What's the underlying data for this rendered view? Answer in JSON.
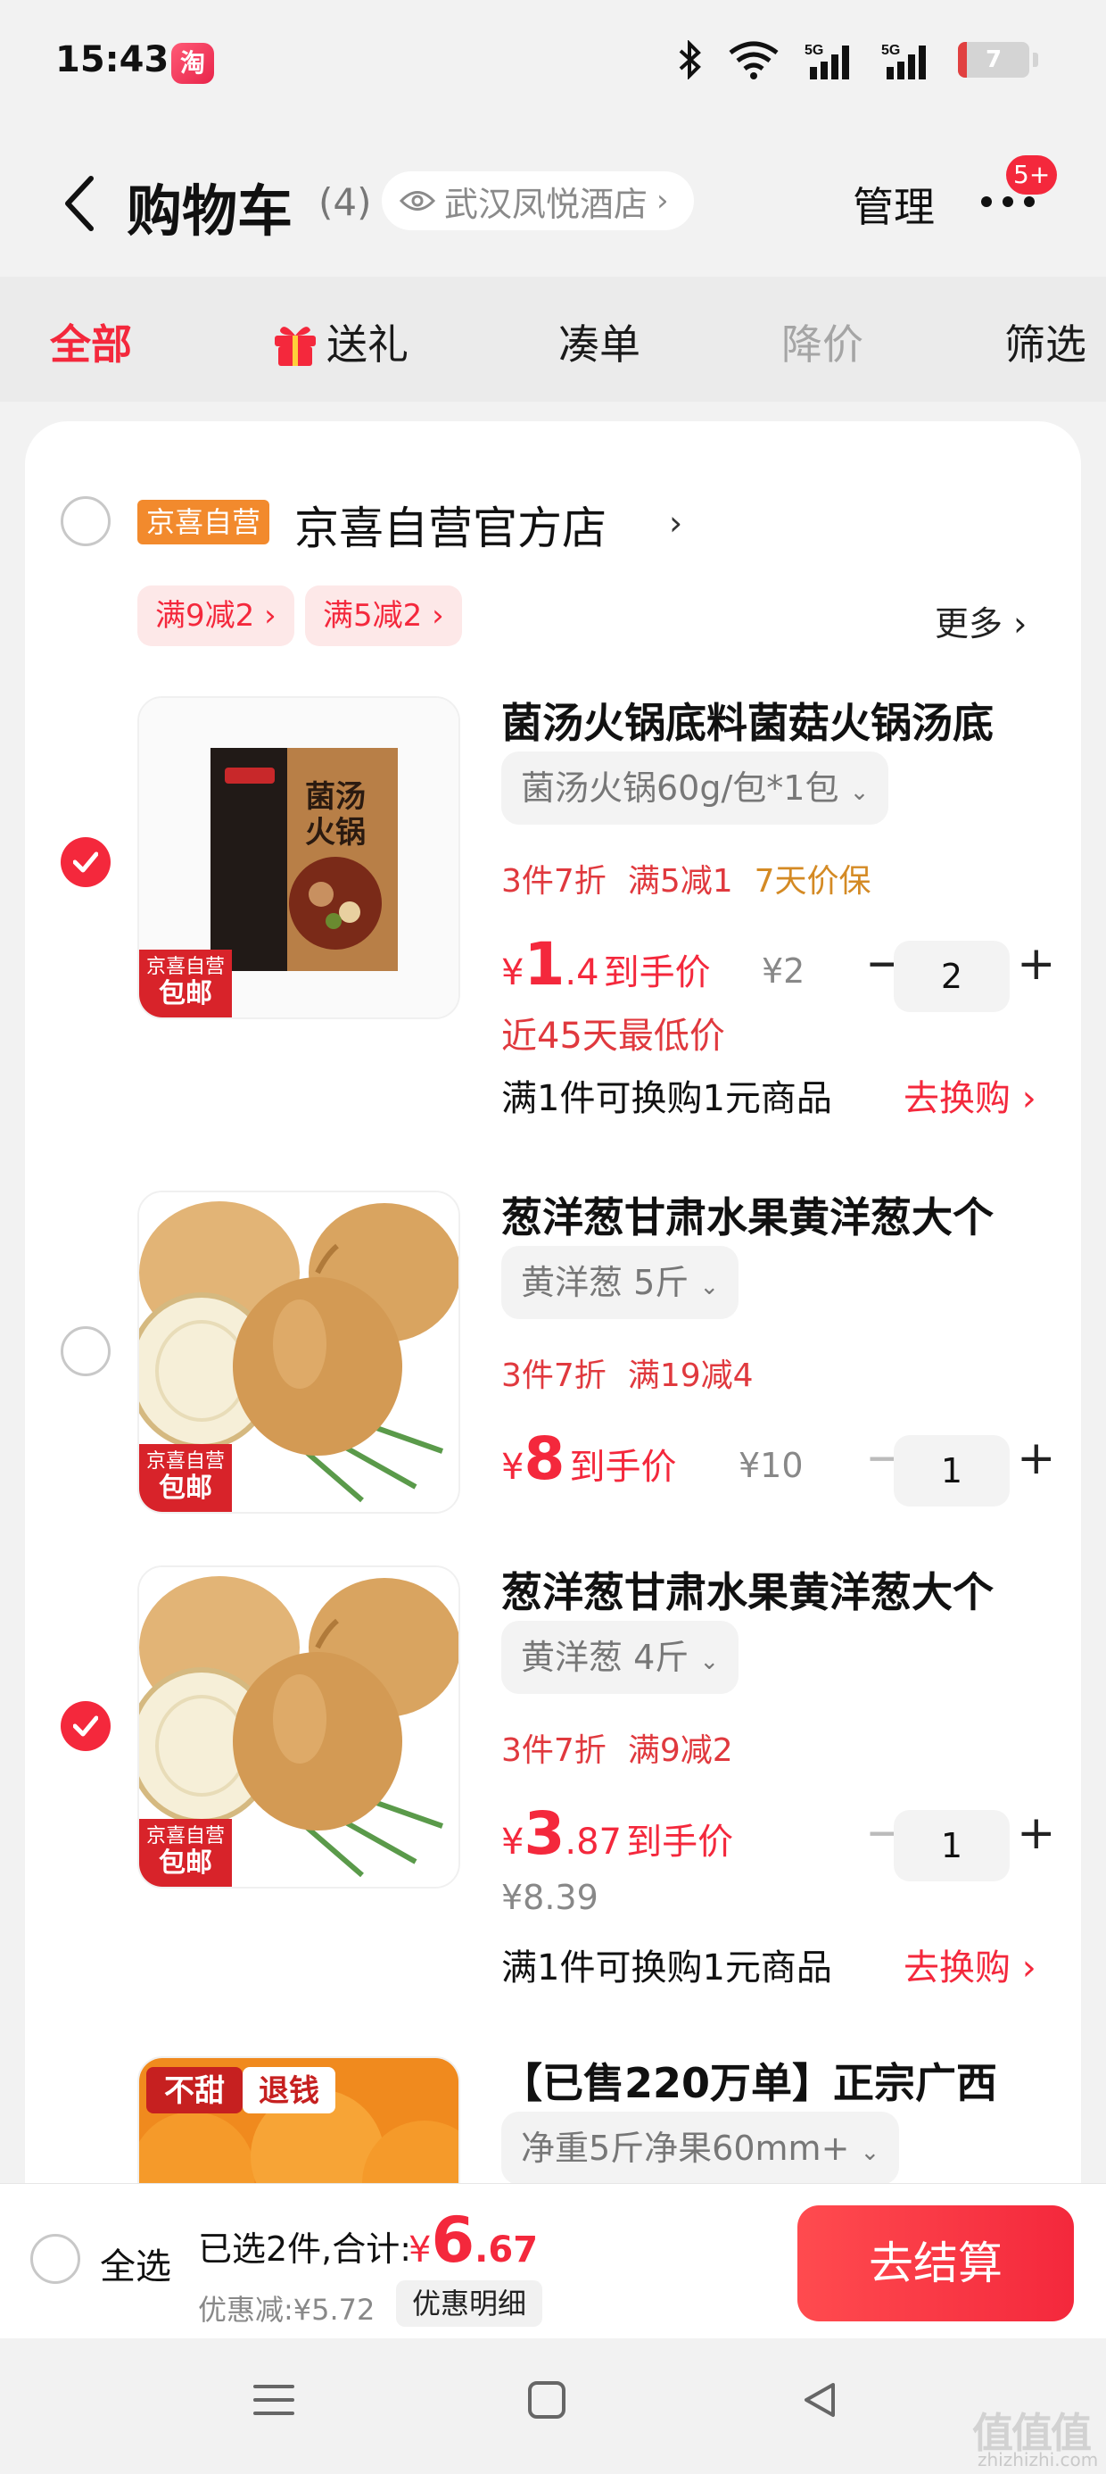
{
  "status_bar": {
    "time": "15:43",
    "app_badge": "淘",
    "battery": "7"
  },
  "header": {
    "title": "购物车",
    "count": "(4)",
    "location": "武汉凤悦酒店",
    "manage": "管理",
    "more_badge": "5+"
  },
  "tabs": [
    {
      "label": "全部",
      "state": "active"
    },
    {
      "label": "送礼",
      "state": "normal",
      "icon": "gift-icon"
    },
    {
      "label": "凑单",
      "state": "normal"
    },
    {
      "label": "降价",
      "state": "disabled"
    },
    {
      "label": "筛选",
      "state": "normal"
    }
  ],
  "store": {
    "tag": "京喜自营",
    "name": "京喜自营官方店",
    "promos": [
      "满9减2",
      "满5减2"
    ],
    "more": "更多"
  },
  "items": [
    {
      "checked": true,
      "title": "菌汤火锅底料菌菇火锅汤底",
      "spec": "菌汤火锅60g/包*1包",
      "tags": [
        "3件7折",
        "满5减1",
        "7天价保"
      ],
      "price_int": "1",
      "price_dec": ".4",
      "price_label": "到手价",
      "orig_price": "¥2",
      "lowest": "近45天最低价",
      "swap_text": "满1件可换购1元商品",
      "swap_link": "去换购 ›",
      "quantity": "2",
      "thumb_tag_top": "京喜自营",
      "thumb_tag_bottom": "包邮"
    },
    {
      "checked": false,
      "title": "葱洋葱甘肃水果黄洋葱大个",
      "spec": "黄洋葱 5斤",
      "tags": [
        "3件7折",
        "满19减4"
      ],
      "price_int": "8",
      "price_dec": "",
      "price_label": "到手价",
      "orig_price": "¥10",
      "quantity": "1",
      "thumb_tag_top": "京喜自营",
      "thumb_tag_bottom": "包邮"
    },
    {
      "checked": true,
      "title": "葱洋葱甘肃水果黄洋葱大个",
      "spec": "黄洋葱 4斤",
      "tags": [
        "3件7折",
        "满9减2"
      ],
      "price_int": "3",
      "price_dec": ".87",
      "price_label": "到手价",
      "orig_price": "¥8.39",
      "swap_text": "满1件可换购1元商品",
      "swap_link": "去换购 ›",
      "quantity": "1",
      "thumb_tag_top": "京喜自营",
      "thumb_tag_bottom": "包邮"
    },
    {
      "checked": false,
      "title": "【已售220万单】正宗广西",
      "spec": "净重5斤净果60mm+",
      "thumb_banner_a": "不甜",
      "thumb_banner_b": "退钱"
    }
  ],
  "checkout": {
    "select_all": "全选",
    "summary": "已选2件,合计:",
    "total_yen": "¥",
    "total_int": "6",
    "total_dec": ".67",
    "discount": "优惠减:¥5.72",
    "detail_button": "优惠明细",
    "checkout_button": "去结算"
  },
  "watermark": {
    "text": "值值值",
    "url": "zhizhizhi.com"
  },
  "colors": {
    "accent": "#f4283c",
    "store_tag": "#f28a2d",
    "warm_tag": "#d48a24"
  }
}
